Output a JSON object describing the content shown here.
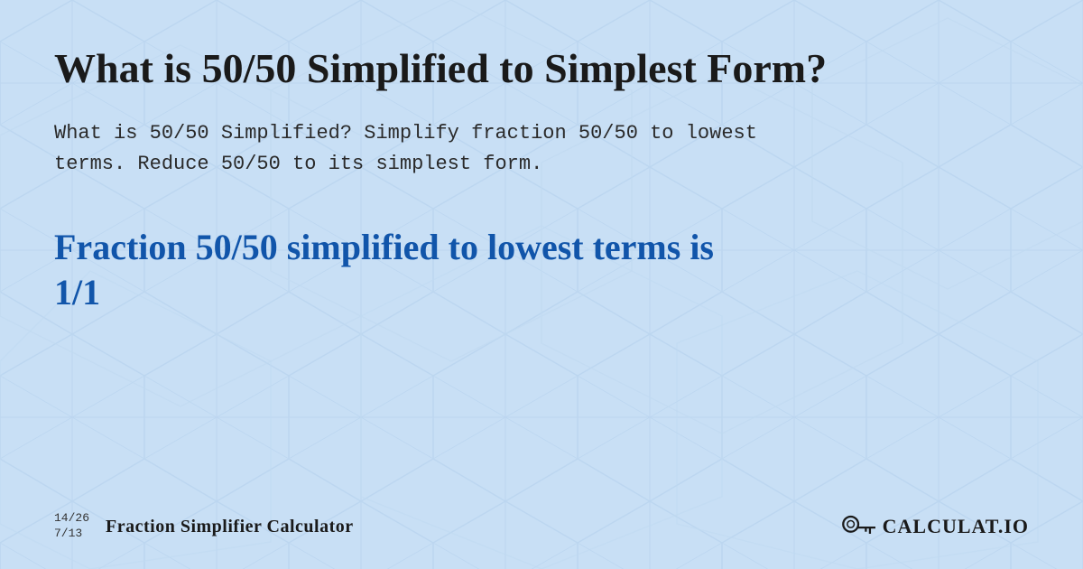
{
  "page": {
    "title": "What is 50/50 Simplified to Simplest Form?",
    "description": "What is 50/50 Simplified? Simplify fraction 50/50 to lowest\nterms. Reduce 50/50 to its simplest form.",
    "result_heading": "Fraction 50/50 simplified to lowest terms is\n1/1"
  },
  "footer": {
    "fraction_top": "14/26",
    "fraction_bottom": "7/13",
    "brand_label": "Fraction Simplifier Calculator",
    "logo_text": "CALCULAT.IO"
  },
  "background": {
    "color": "#c8dff5"
  }
}
